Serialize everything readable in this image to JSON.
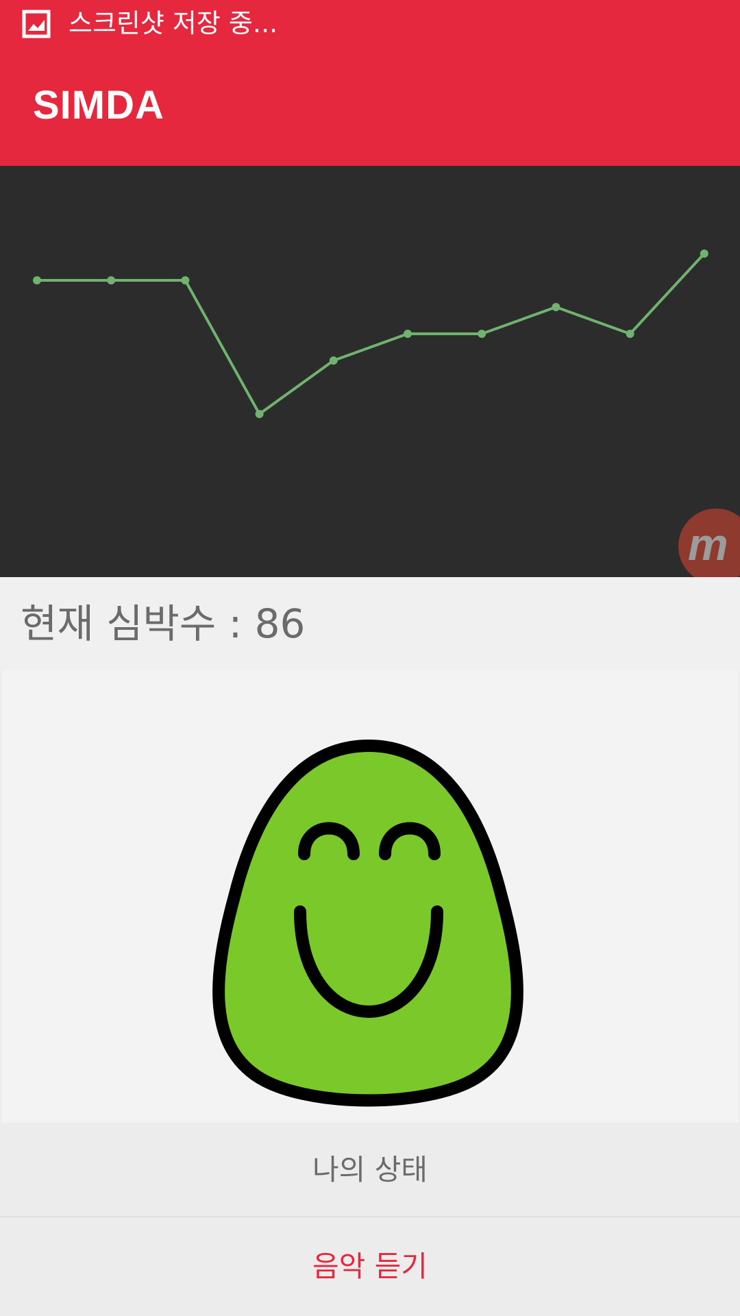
{
  "status_bar": {
    "icon": "image-icon",
    "text": "스크린샷 저장 중..."
  },
  "app_bar": {
    "title": "SIMDA"
  },
  "chart_data": {
    "type": "line",
    "series": [
      {
        "values": [
          70,
          70,
          70,
          20,
          40,
          50,
          50,
          60,
          50,
          80
        ]
      }
    ],
    "ylim": [
      0,
      100
    ],
    "grid": false,
    "line_color": "#6fb36f",
    "background": "#2c2c2c"
  },
  "floating_badge": {
    "icon": "m-logo-icon",
    "label": "m"
  },
  "heart_rate": {
    "text": "현재 심박수 : 86",
    "value": 86
  },
  "mood": {
    "icon": "smiling-face-icon",
    "face_color": "#7ac82a"
  },
  "buttons": {
    "status_label": "나의 상태",
    "music_label": "음악 듣기"
  },
  "colors": {
    "accent": "#e6283e",
    "text_gray": "#6b6b6b"
  }
}
